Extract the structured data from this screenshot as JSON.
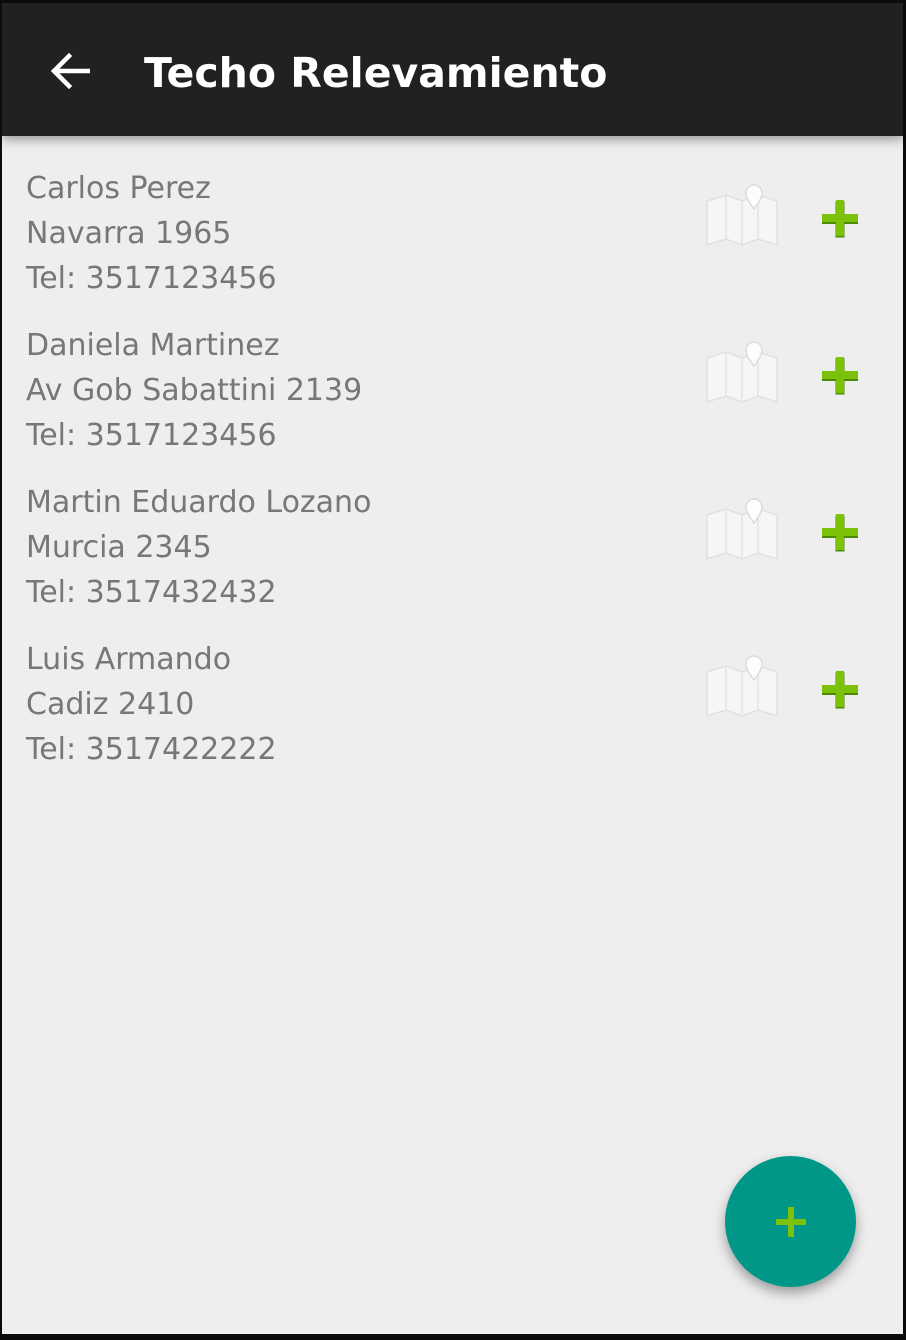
{
  "appbar": {
    "title": "Techo Relevamiento",
    "back_icon": "arrow-left-icon"
  },
  "items": [
    {
      "name": "Carlos Perez",
      "address": "Navarra 1965",
      "phone": "Tel: 3517123456",
      "map_icon": "map-icon",
      "add_icon": "plus-icon"
    },
    {
      "name": "Daniela Martinez",
      "address": "Av Gob Sabattini 2139",
      "phone": "Tel: 3517123456",
      "map_icon": "map-icon",
      "add_icon": "plus-icon"
    },
    {
      "name": "Martin Eduardo Lozano",
      "address": "Murcia 2345",
      "phone": "Tel: 3517432432",
      "map_icon": "map-icon",
      "add_icon": "plus-icon"
    },
    {
      "name": "Luis Armando",
      "address": "Cadiz 2410",
      "phone": "Tel: 3517422222",
      "map_icon": "map-icon",
      "add_icon": "plus-icon"
    }
  ],
  "fab": {
    "icon": "plus-icon"
  },
  "colors": {
    "appbar": "#212121",
    "background": "#eeeeee",
    "text": "#777777",
    "accent_green": "#76b900",
    "fab": "#009688"
  }
}
